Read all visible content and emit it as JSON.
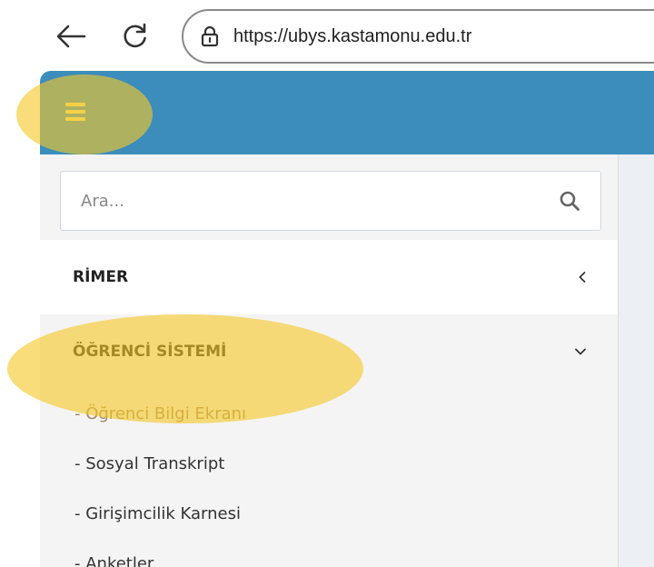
{
  "browser": {
    "url": "https://ubys.kastamonu.edu.tr",
    "back_icon": "arrow-left-icon",
    "reload_icon": "reload-icon",
    "lock_icon": "lock-icon"
  },
  "topbar": {
    "color": "#3c8dbc",
    "menu_icon": "hamburger-icon"
  },
  "search": {
    "placeholder": "Ara...",
    "value": "",
    "icon": "search-icon"
  },
  "sidebar": {
    "sections": [
      {
        "label": "RİMER",
        "icon": "chevron-left-icon",
        "expanded": false
      },
      {
        "label": "ÖĞRENCİ SİSTEMİ",
        "icon": "chevron-down-icon",
        "expanded": true
      }
    ],
    "submenu": [
      {
        "label": "- Öğrenci Bilgi Ekranı",
        "active": true
      },
      {
        "label": "- Sosyal Transkript",
        "active": false
      },
      {
        "label": "- Girişimcilik Karnesi",
        "active": false
      },
      {
        "label": "- Anketler",
        "active": false
      }
    ]
  },
  "highlight_color": "#f5c828"
}
